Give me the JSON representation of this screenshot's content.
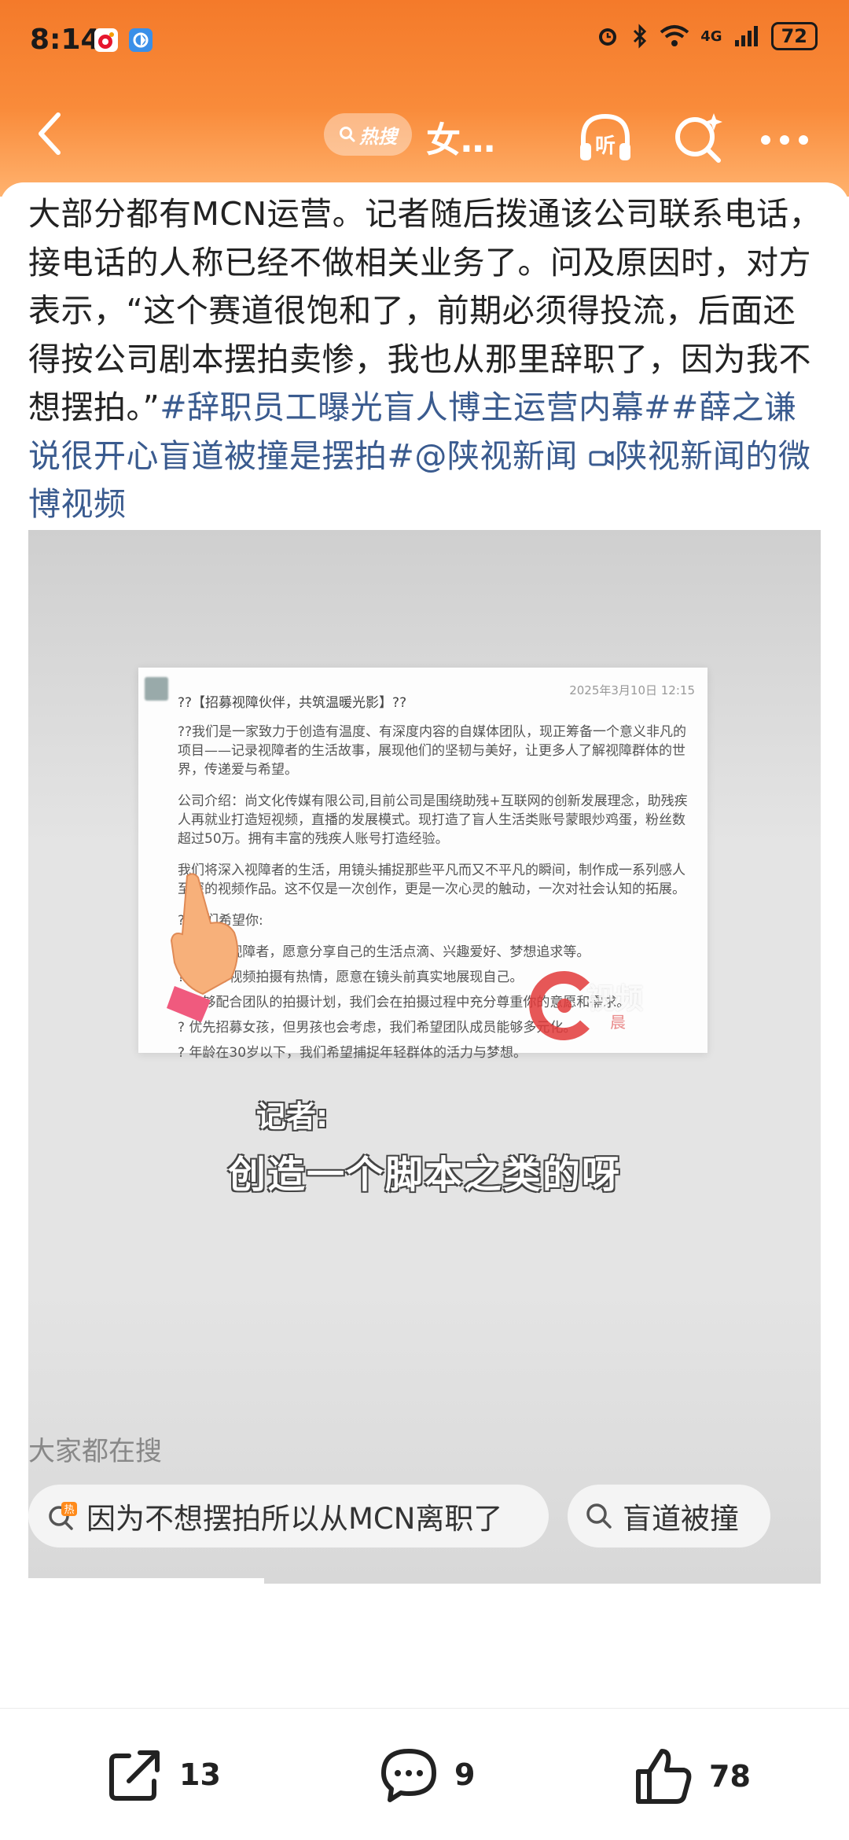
{
  "status_bar": {
    "time": "8:14",
    "network": "4G",
    "battery": "72"
  },
  "nav": {
    "hot_label": "热搜",
    "title": "女…",
    "listen_label": "听"
  },
  "post": {
    "text_plain": "大部分都有MCN运营。记者随后拨通该公司联系电话，接电话的人称已经不做相关业务了。问及原因时，对方表示，“这个赛道很饱和了，前期必须得投流，后面还得按公司剧本摆拍卖惨，我也从那里辞职了，因为我不想摆拍。”",
    "tag1": "#辞职员工曝光盲人博主运营内幕#",
    "tag2": "#薛之谦说很开心盲道被撞是摆拍#",
    "mention": "@陕视新闻",
    "video_link": "陕视新闻的微博视频"
  },
  "video": {
    "doc_date": "2025年3月10日 12:15",
    "doc_heading": "??【招募视障伙伴，共筑温暖光影】??",
    "doc_p1": "??我们是一家致力于创造有温度、有深度内容的自媒体团队，现正筹备一个意义非凡的项目——记录视障者的生活故事，展现他们的坚韧与美好，让更多人了解视障群体的世界，传递爱与希望。",
    "doc_p2": "公司介绍：尚文化传媒有限公司,目前公司是围绕助残+互联网的创新发展理念，助残疾人再就业打造短视频，直播的发展模式。现打造了盲人生活类账号蒙眼炒鸡蛋，粉丝数超过50万。拥有丰富的残疾人账号打造经验。",
    "doc_p3": "我们将深入视障者的生活，用镜头捕捉那些平凡而又不平凡的瞬间，制作成一系列感人至深的视频作品。这不仅是一次创作，更是一次心灵的触动，一次对社会认知的拓展。",
    "doc_p4": "??我们希望你:",
    "doc_r1": "? 是一位视障者，愿意分享自己的生活点滴、兴趣爱好、梦想追求等。",
    "doc_r2": "? 对参与视频拍摄有热情，愿意在镜头前真实地展现自己。",
    "doc_r3": "? 能够配合团队的拍摄计划，我们会在拍摄过程中充分尊重你的意愿和需求。",
    "doc_r4": "? 优先招募女孩，但男孩也会考虑，我们希望团队成员能够多元化。",
    "doc_r5": "? 年龄在30岁以下，我们希望捕捉年轻群体的活力与梦想。",
    "watermark_text": "视频",
    "watermark_sub": "晨",
    "subtitle_speaker": "记者:",
    "subtitle_line": "创造一个脚本之类的呀"
  },
  "search": {
    "title": "大家都在搜",
    "chips": [
      {
        "label": "因为不想摆拍所以从MCN离职了",
        "badge": "热"
      },
      {
        "label": "盲道被撞"
      }
    ]
  },
  "actions": {
    "share_count": "13",
    "comment_count": "9",
    "like_count": "78"
  },
  "colors": {
    "header_orange": "#f47a2a",
    "tag_blue": "#3a5b8f"
  }
}
